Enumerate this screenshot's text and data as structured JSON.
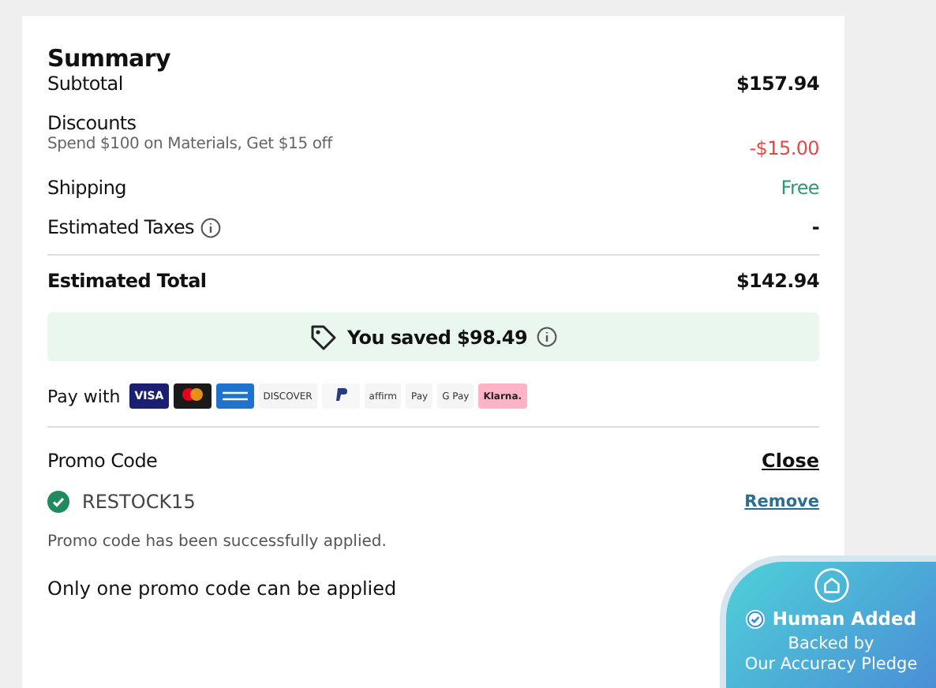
{
  "summary": {
    "title": "Summary",
    "rows": [
      {
        "kind": "plain",
        "label": "Subtotal",
        "value": "$157.94"
      },
      {
        "kind": "discount",
        "label": "Discounts",
        "note": "Spend $100 on Materials, Get $15 off",
        "value": "-$15.00"
      },
      {
        "kind": "free",
        "label": "Shipping",
        "value": "Free"
      },
      {
        "kind": "info",
        "label": "Estimated Taxes",
        "value": "-"
      }
    ],
    "total": {
      "label": "Estimated Total",
      "value": "$142.94"
    },
    "savings": {
      "text": "You saved $98.49"
    },
    "pay_with": {
      "label": "Pay with",
      "methods": [
        {
          "kind": "visa",
          "label": "VISA"
        },
        {
          "kind": "mastercard"
        },
        {
          "kind": "amex"
        },
        {
          "kind": "discover",
          "label": "DISCOVER"
        },
        {
          "kind": "paypal"
        },
        {
          "kind": "affirm",
          "label": "affirm"
        },
        {
          "kind": "applepay",
          "label": "Pay"
        },
        {
          "kind": "gpay",
          "label": "G Pay"
        },
        {
          "kind": "klarna",
          "label": "Klarna."
        }
      ]
    },
    "promo": {
      "title": "Promo Code",
      "close": "Close",
      "code": "RESTOCK15",
      "applied": true,
      "remove": "Remove",
      "message": "Promo code has been successfully applied.",
      "limit_note": "Only one promo code can be applied"
    }
  },
  "badge": {
    "title": "Human Added",
    "subtitle": "Backed by",
    "subtitle_2": "Our Accuracy Pledge"
  }
}
